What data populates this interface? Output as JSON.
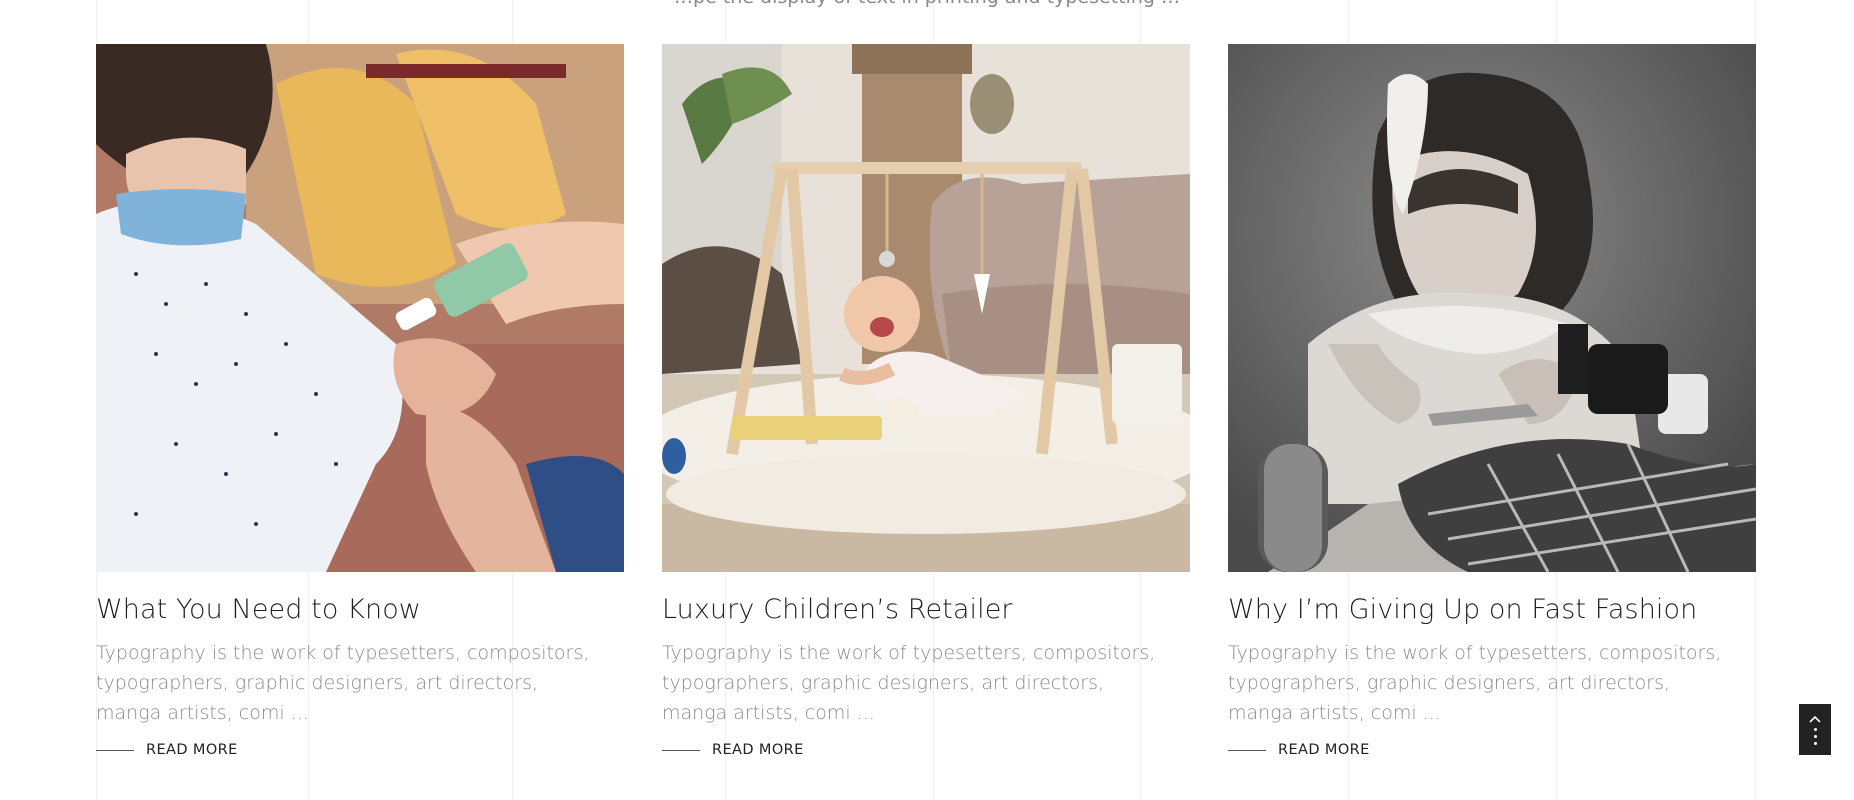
{
  "cut_off_text": "…pe the display of text in printing and typesetting …",
  "posts": [
    {
      "image_alt": "Child with face mask having hands sanitized",
      "title": "What You Need to Know",
      "excerpt": "Typography is the work of typesetters, compositors, typographers, graphic designers, art directors, manga artists, comi ...",
      "read_more": "READ MORE"
    },
    {
      "image_alt": "Laughing baby under a wooden play gym",
      "title": "Luxury Children’s Retailer",
      "excerpt": "Typography is the work of typesetters, compositors, typographers, graphic designers, art directors, manga artists, comi ...",
      "read_more": "READ MORE"
    },
    {
      "image_alt": "Vintage black and white photo of girl sewing fabric",
      "title": "Why I’m Giving Up on Fast Fashion",
      "excerpt": "Typography is the work of typesetters, compositors, typographers, graphic designers, art directors, manga artists, comi ...",
      "read_more": "READ MORE"
    }
  ],
  "back_to_top": {
    "icon": "chevron-up-icon"
  },
  "colors": {
    "text_dark": "#1f1f1f",
    "text_muted": "#8b8b8b",
    "button_bg": "#222222"
  }
}
